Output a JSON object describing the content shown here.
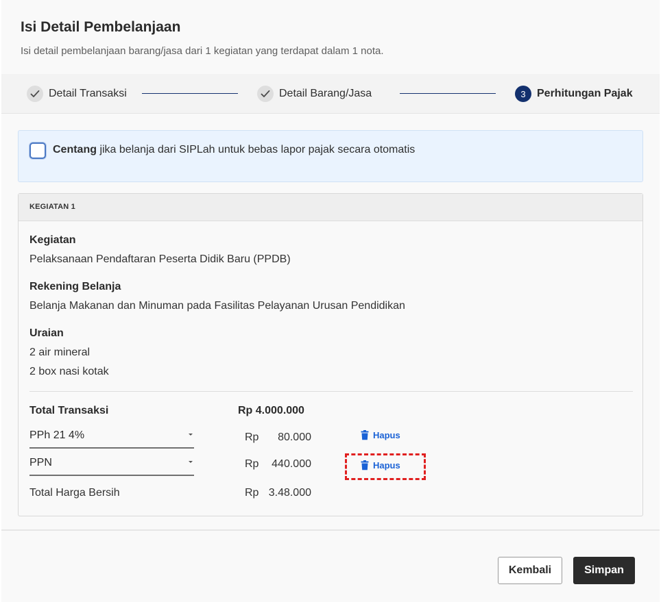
{
  "header": {
    "title": "Isi Detail Pembelanjaan",
    "subtitle": "Isi detail pembelanjaan barang/jasa dari 1 kegiatan yang terdapat dalam 1 nota."
  },
  "stepper": {
    "steps": [
      {
        "label": "Detail Transaksi",
        "state": "done"
      },
      {
        "label": "Detail Barang/Jasa",
        "state": "done"
      },
      {
        "label": "Perhitungan Pajak",
        "state": "active",
        "number": "3"
      }
    ],
    "accent": "#13306e"
  },
  "notice": {
    "bold": "Centang",
    "text": " jika belanja dari SIPLah untuk bebas lapor pajak secara otomatis",
    "checked": false
  },
  "card": {
    "header": "KEGIATAN 1",
    "kegiatan_label": "Kegiatan",
    "kegiatan_value": "Pelaksanaan Pendaftaran Peserta Didik Baru (PPDB)",
    "rekening_label": "Rekening Belanja",
    "rekening_value": "Belanja Makanan dan Minuman pada Fasilitas Pelayanan Urusan Pendidikan",
    "uraian_label": "Uraian",
    "uraian_items": [
      "2 air mineral",
      "2 box nasi kotak"
    ],
    "total_label": "Total Transaksi",
    "total_value": "Rp 4.000.000",
    "taxes": [
      {
        "name": "PPh 21 4%",
        "currency": "Rp",
        "amount": "80.000",
        "delete_label": "Hapus"
      },
      {
        "name": "PPN",
        "currency": "Rp",
        "amount": "440.000",
        "delete_label": "Hapus"
      }
    ],
    "net_label": "Total Harga Bersih",
    "net_currency": "Rp",
    "net_amount": "3.48.000"
  },
  "footer": {
    "back_label": "Kembali",
    "save_label": "Simpan"
  },
  "colors": {
    "link": "#1a62d6",
    "highlight": "#e02020",
    "notice_bg": "#eaf3fe"
  }
}
